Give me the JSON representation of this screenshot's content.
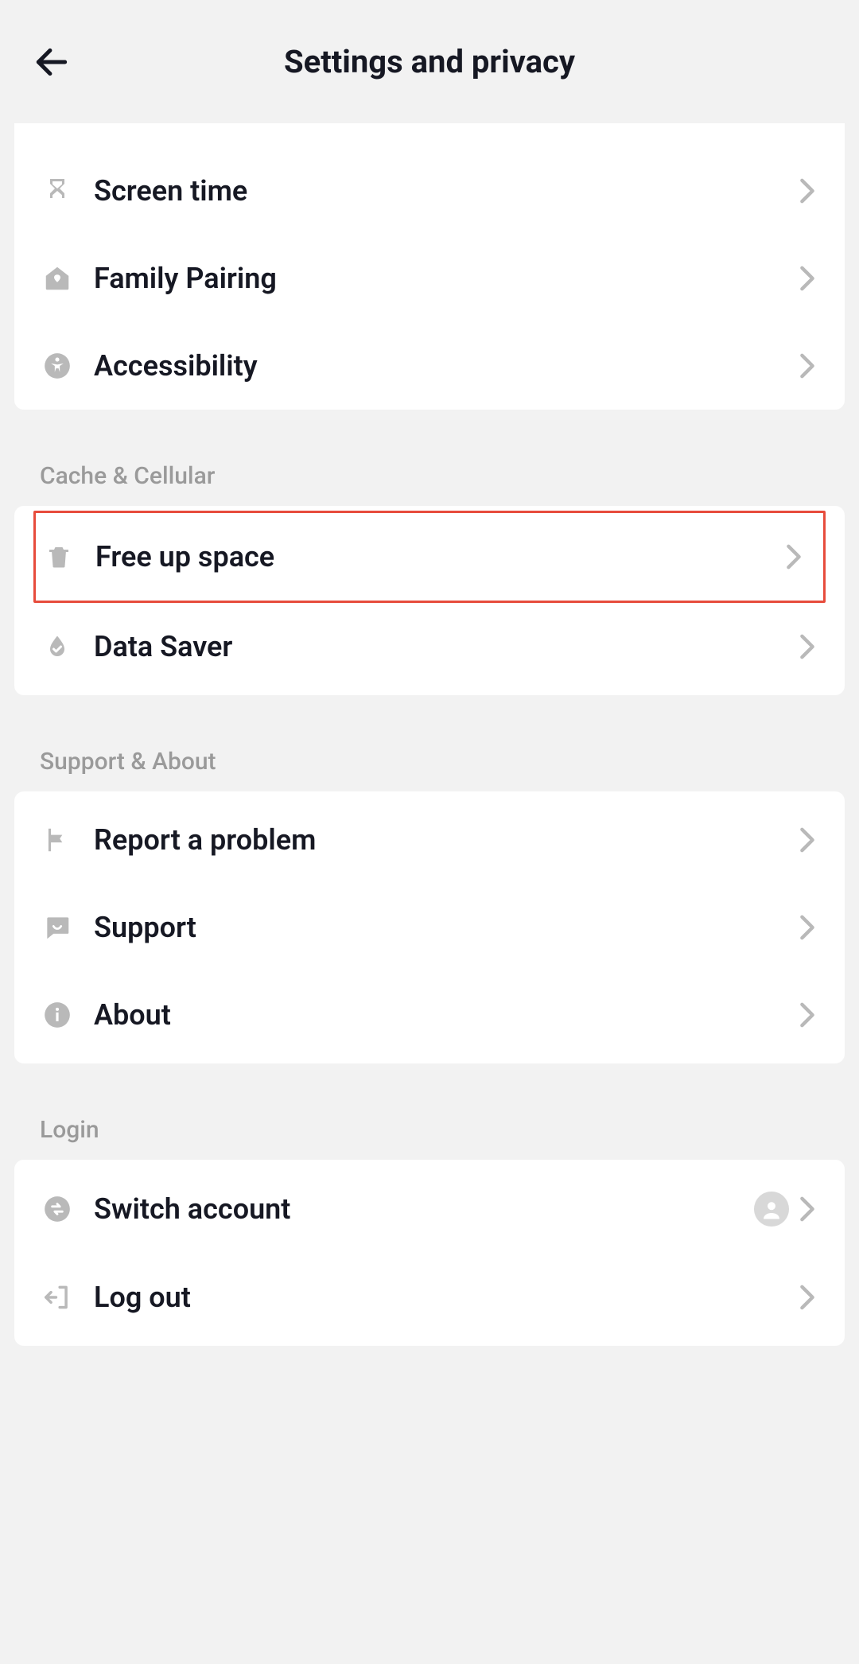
{
  "header": {
    "title": "Settings and privacy"
  },
  "group0": {
    "items": [
      {
        "label": "Screen time"
      },
      {
        "label": "Family Pairing"
      },
      {
        "label": "Accessibility"
      }
    ]
  },
  "group1": {
    "title": "Cache & Cellular",
    "items": [
      {
        "label": "Free up space"
      },
      {
        "label": "Data Saver"
      }
    ]
  },
  "group2": {
    "title": "Support & About",
    "items": [
      {
        "label": "Report a problem"
      },
      {
        "label": "Support"
      },
      {
        "label": "About"
      }
    ]
  },
  "group3": {
    "title": "Login",
    "items": [
      {
        "label": "Switch account"
      },
      {
        "label": "Log out"
      }
    ]
  }
}
